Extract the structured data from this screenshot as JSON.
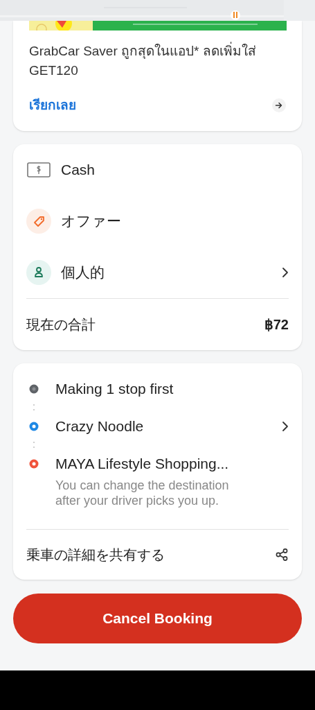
{
  "promo": {
    "text": "GrabCar Saver ถูกสุดในแอป* ลดเพิ่มใส่ GET120",
    "link": "เรียกเลย"
  },
  "payment": {
    "items": [
      {
        "kind": "cash",
        "label": "Cash",
        "chevron": false
      },
      {
        "kind": "offer",
        "label": "オファー",
        "chevron": false
      },
      {
        "kind": "profile",
        "label": "個人的",
        "chevron": true
      }
    ],
    "total_label": "現在の合計",
    "total": "฿72"
  },
  "route": {
    "stops": [
      {
        "label": "Making 1 stop first",
        "color": "#5f6368",
        "chevron": false
      },
      {
        "label": "Crazy Noodle",
        "color": "#1e88e5",
        "chevron": true
      },
      {
        "label": "MAYA Lifestyle Shopping...",
        "color": "#f0533b",
        "chevron": false,
        "note": "You can change the destination after your driver picks you up."
      }
    ],
    "share": "乗車の詳細を共有する"
  },
  "cancel_button": "Cancel Booking"
}
